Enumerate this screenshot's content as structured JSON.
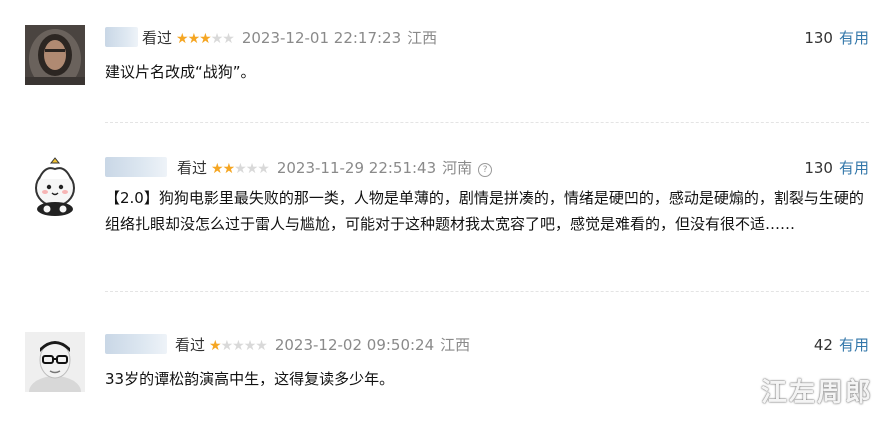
{
  "comments": [
    {
      "username": "",
      "status": "看过",
      "rating": 3,
      "time": "2023-12-01 22:17:23",
      "region": "江西",
      "show_help": false,
      "votes": "130",
      "useful_label": "有用",
      "content": "建议片名改成“战狗”。"
    },
    {
      "username": "",
      "status": "看过",
      "rating": 2,
      "time": "2023-11-29 22:51:43",
      "region": "河南",
      "show_help": true,
      "votes": "130",
      "useful_label": "有用",
      "content": "【2.0】狗狗电影里最失败的那一类，人物是单薄的，剧情是拼凑的，情绪是硬凹的，感动是硬煽的，割裂与生硬的组络扎眼却没怎么过于雷人与尴尬，可能对于这种题材我太宽容了吧，感觉是难看的，但没有很不适……"
    },
    {
      "username": "",
      "status": "看过",
      "rating": 1,
      "time": "2023-12-02 09:50:24",
      "region": "江西",
      "show_help": false,
      "votes": "42",
      "useful_label": "有用",
      "content": "33岁的谭松韵演高中生，这得复读多少年。"
    }
  ],
  "help_icon": "question-circle-icon",
  "watermark": "江左周郎",
  "colors": {
    "star_on": "#f5a623",
    "star_off": "#d9d9d9",
    "link": "#3377aa",
    "muted": "#8a8a8a"
  }
}
